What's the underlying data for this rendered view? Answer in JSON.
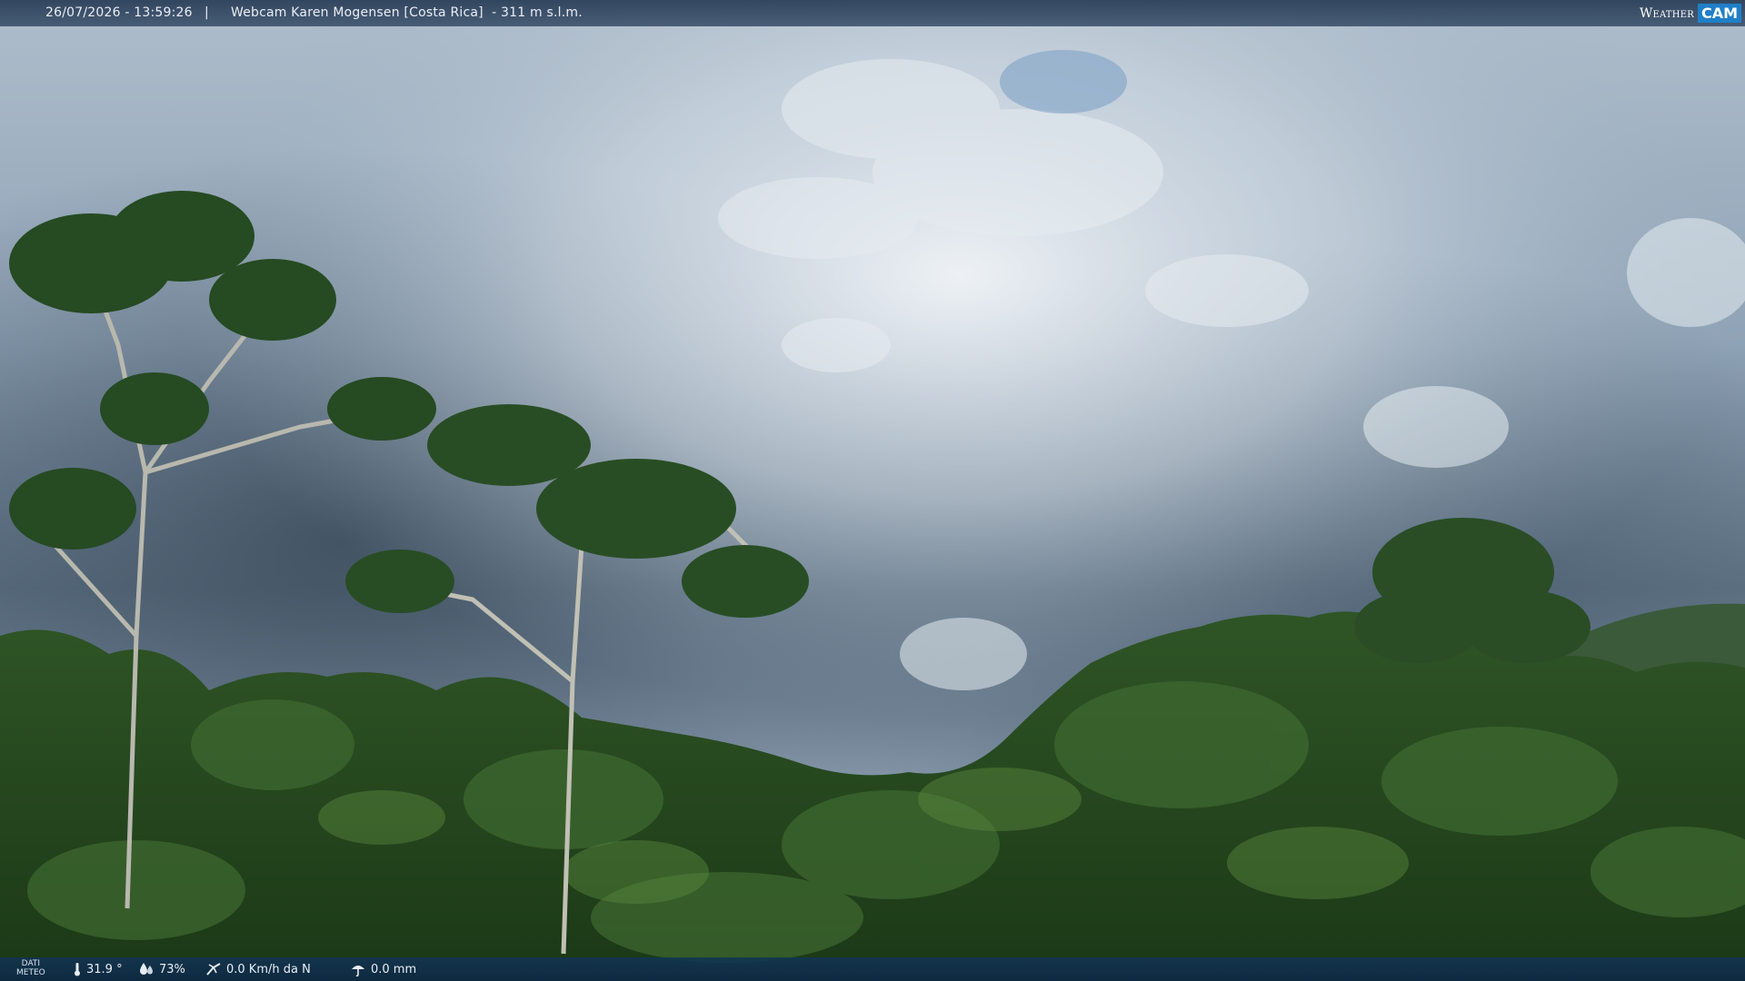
{
  "overlay": {
    "timestamp": "26/07/2026 - 13:59:26",
    "separator": "|",
    "title": "Webcam Karen Mogensen [Costa Rica]  - 311 m s.l.m.",
    "logo": {
      "word": "Weather",
      "badge": "CAM",
      "badge_color": "#1f7fc8"
    }
  },
  "weather": {
    "label_line1": "DATI",
    "label_line2": "METEO",
    "temperature": "31.9 °",
    "humidity": "73%",
    "wind": "0.0 Km/h da N",
    "rain": "0.0 mm"
  },
  "icons": {
    "temperature": "thermometer-icon",
    "humidity": "humidity-drop-icon",
    "wind": "wind-vane-icon",
    "rain": "rain-gauge-icon"
  },
  "colors": {
    "top_bar": "#2c4460",
    "bottom_bar": "#123454",
    "sky": "#7d93a8",
    "foliage": "#2f5a26"
  }
}
